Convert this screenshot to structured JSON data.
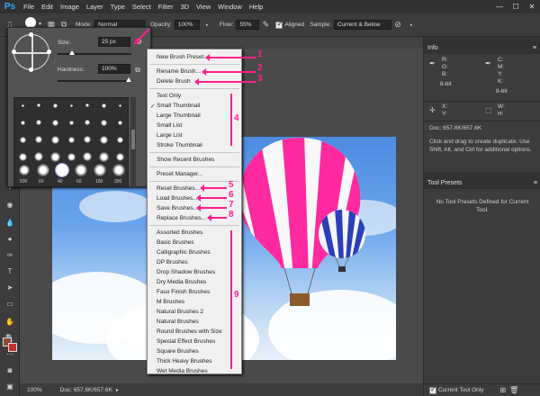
{
  "app": {
    "logo": "Ps"
  },
  "menubar": {
    "items": [
      "File",
      "Edit",
      "Image",
      "Layer",
      "Type",
      "Select",
      "Filter",
      "3D",
      "View",
      "Window",
      "Help"
    ]
  },
  "window_controls": {
    "minimize": "—",
    "maximize": "☐",
    "close": "✕"
  },
  "options": {
    "brush_size_badge": "25",
    "mode_label": "Mode:",
    "mode_value": "Normal",
    "opacity_label": "Opacity:",
    "opacity_value": "100%",
    "flow_label": "Flow:",
    "flow_value": "55%",
    "aligned_label": "Aligned",
    "sample_label": "Sample:",
    "sample_value": "Current & Below"
  },
  "brush_picker": {
    "size_label": "Size:",
    "size_value": "25 px",
    "hardness_label": "Hardness:",
    "hardness_value": "100%",
    "size_fraction": 0.2,
    "hardness_fraction": 1.0,
    "brush_numbers": [
      "60",
      "1",
      "3",
      "5",
      "9",
      "13",
      "19",
      "5",
      "9",
      "13",
      "17",
      "21",
      "27",
      "35",
      "45",
      "65",
      "100",
      "200",
      "300",
      "9",
      "13",
      "19",
      "17",
      "45",
      "65",
      "100",
      "200",
      "300",
      "14",
      "24",
      "27",
      "39",
      "46",
      "59",
      "11",
      "17",
      "23",
      "36",
      "44",
      "60",
      "14",
      "26",
      "33",
      "42",
      "55",
      "70",
      "112",
      "134",
      "74",
      "95",
      "29",
      "192",
      "36",
      "33",
      "63",
      "66",
      "39",
      "63",
      "11",
      "48",
      "32",
      "55",
      "100",
      "75",
      "45",
      "1",
      "3",
      "5",
      "9",
      "13",
      "19",
      "5",
      "9",
      "13",
      "17",
      "21",
      "27",
      "35",
      "45",
      "65",
      "100",
      "200",
      "300",
      "9",
      "13",
      "19",
      "17",
      "45",
      "65",
      "100",
      "200",
      "300",
      "500",
      "60",
      "40",
      "60",
      "100",
      "300"
    ],
    "bottom_labels": [
      "500",
      "60",
      "40",
      "60",
      "100",
      "300"
    ]
  },
  "dropdown_menu": {
    "items": {
      "new_preset": "New Brush Preset...",
      "rename": "Rename Brush...",
      "delete": "Delete Brush",
      "text_only": "Text Only",
      "small_thumb": "Small Thumbnail",
      "large_thumb": "Large Thumbnail",
      "small_list": "Small List",
      "large_list": "Large List",
      "stroke_thumb": "Stroke Thumbnail",
      "show_recent": "Show Recent Brushes",
      "preset_manager": "Preset Manager...",
      "reset": "Reset Brushes...",
      "load": "Load Brushes...",
      "save": "Save Brushes...",
      "replace": "Replace Brushes...",
      "assorted": "Assorted Brushes",
      "basic": "Basic Brushes",
      "calligraphic": "Calligraphic Brushes",
      "dp": "DP Brushes",
      "drop_shadow": "Drop Shadow Brushes",
      "dry_media": "Dry Media Brushes",
      "faux_finish": "Faux Finish Brushes",
      "m": "M Brushes",
      "natural2": "Natural Brushes 2",
      "natural": "Natural Brushes",
      "round_size": "Round Brushes with Size",
      "special_effect": "Special Effect Brushes",
      "square": "Square Brushes",
      "thick_heavy": "Thick Heavy Brushes",
      "wet_media": "Wet Media Brushes"
    },
    "checkmark": "✓"
  },
  "annotations": {
    "n1": "1",
    "n2": "2",
    "n3": "3",
    "n4": "4",
    "n5": "5",
    "n6": "6",
    "n7": "7",
    "n8": "8",
    "n9": "9"
  },
  "info_panel": {
    "title": "Info",
    "r": "R:",
    "g": "G:",
    "b": "B:",
    "c": "C:",
    "m": "M:",
    "y": "Y:",
    "k": "K:",
    "bit_left": "8-bit",
    "bit_right": "8-bit",
    "x": "X:",
    "y_coord": "Y:",
    "w": "W:",
    "h": "H:",
    "doc": "Doc: 657.6K/657.6K",
    "hint": "Click and drag to create duplicate.  Use Shift, Alt, and Ctrl for additional options."
  },
  "tool_presets": {
    "title": "Tool Presets",
    "empty": "No Tool Presets Defined for Current Tool.",
    "current_tool_only": "Current Tool Only"
  },
  "status": {
    "zoom": "100%",
    "doc": "Doc: 657.6K/657.6K"
  },
  "colors": {
    "accent": "#ff1f8f",
    "panel": "#3c3c3c",
    "menubar": "#323232",
    "canvas_bg": "#535353"
  }
}
